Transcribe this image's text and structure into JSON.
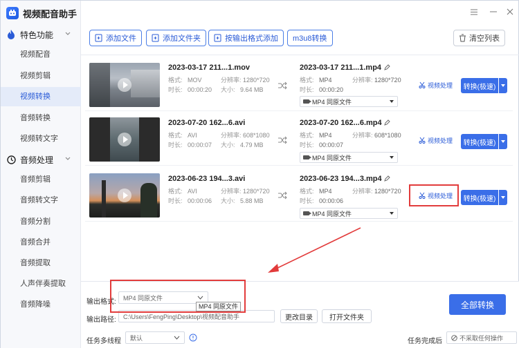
{
  "app": {
    "title": "视频配音助手"
  },
  "sidebar": {
    "sections": [
      {
        "title": "特色功能",
        "items": [
          "视频配音",
          "视频剪辑",
          "视频转换",
          "音频转换",
          "视频转文字"
        ]
      },
      {
        "title": "音频处理",
        "items": [
          "音频剪辑",
          "音频转文字",
          "音频分割",
          "音频合并",
          "音频提取",
          "人声伴奏提取",
          "音频降噪"
        ]
      }
    ],
    "active": "视频转换"
  },
  "toolbar": {
    "add_file": "添加文件",
    "add_folder": "添加文件夹",
    "add_by_format": "按输出格式添加",
    "m3u8": "m3u8转换",
    "clear": "清空列表"
  },
  "files": [
    {
      "src_name": "2023-03-17 211...1.mov",
      "src_format": "MOV",
      "src_resolution": "1280*720",
      "src_duration": "00:00:20",
      "src_size": "9.64 MB",
      "out_name": "2023-03-17 211...1.mp4",
      "out_format": "MP4",
      "out_resolution": "1280*720",
      "out_duration": "00:00:20",
      "out_option": "MP4  同原文件"
    },
    {
      "src_name": "2023-07-20 162...6.avi",
      "src_format": "AVI",
      "src_resolution": "608*1080",
      "src_duration": "00:00:07",
      "src_size": "4.79 MB",
      "out_name": "2023-07-20 162...6.mp4",
      "out_format": "MP4",
      "out_resolution": "608*1080",
      "out_duration": "00:00:07",
      "out_option": "MP4  同原文件"
    },
    {
      "src_name": "2023-06-23 194...3.avi",
      "src_format": "AVI",
      "src_resolution": "1280*720",
      "src_duration": "00:00:06",
      "src_size": "5.88 MB",
      "out_name": "2023-06-23 194...3.mp4",
      "out_format": "MP4",
      "out_resolution": "1280*720",
      "out_duration": "00:00:06",
      "out_option": "MP4  同原文件"
    }
  ],
  "labels": {
    "format": "格式:",
    "resolution": "分辨率:",
    "duration": "时长:",
    "size": "大小:",
    "process": "视频处理",
    "convert": "转换(极速)"
  },
  "bottom": {
    "output_format_label": "输出格式:",
    "output_format_value": "MP4  同原文件",
    "tooltip": "MP4  同原文件",
    "output_path_label": "输出路径:",
    "output_path_value": "C:\\Users\\FengPing\\Desktop\\视频配音助手",
    "change_dir": "更改目录",
    "open_folder": "打开文件夹",
    "threads_label": "任务多线程",
    "threads_value": "默认",
    "after_done_label": "任务完成后",
    "after_done_value": "不采取任何操作",
    "convert_all": "全部转换"
  },
  "colors": {
    "accent": "#3a6ee8",
    "highlight": "#e23b3b"
  }
}
